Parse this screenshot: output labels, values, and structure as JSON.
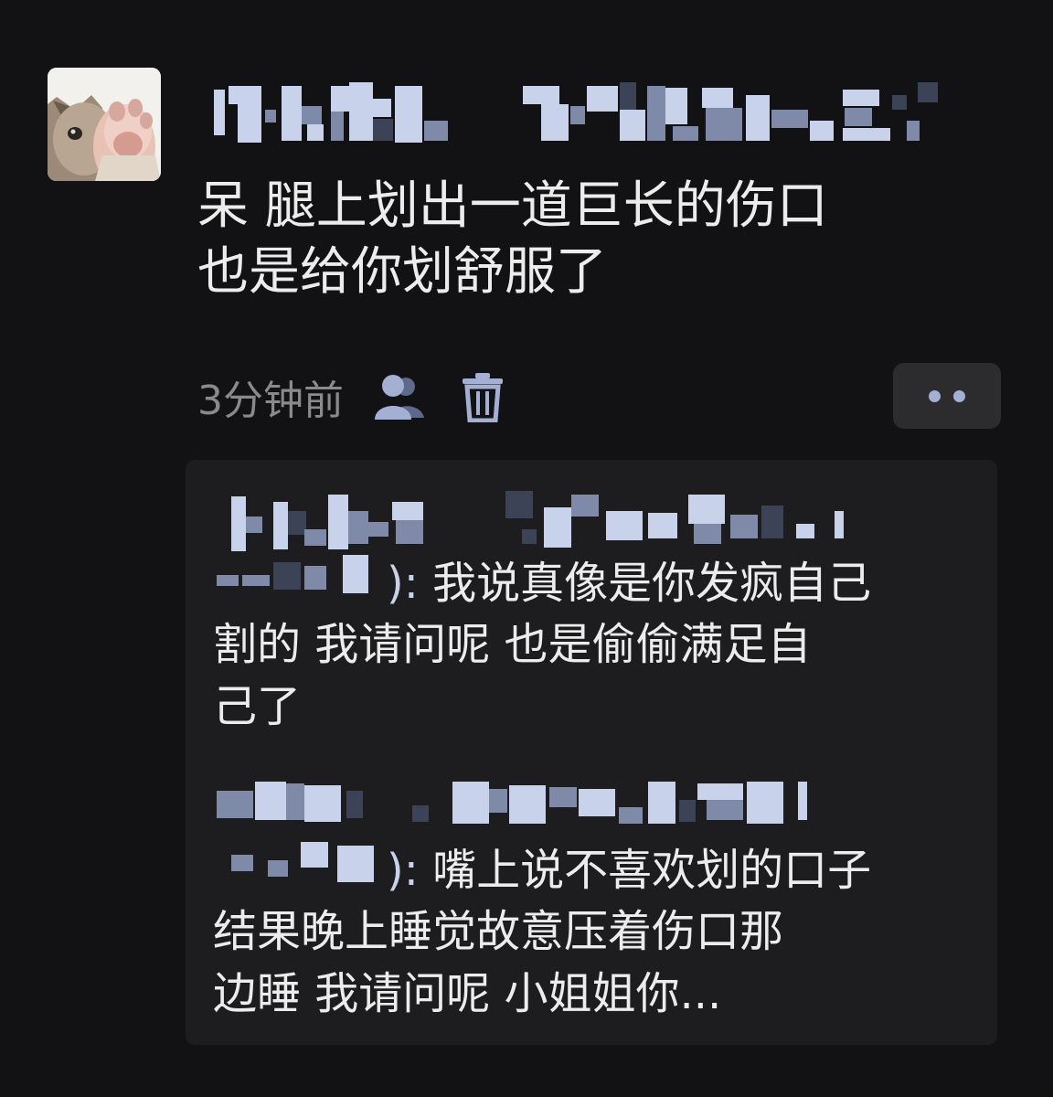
{
  "post": {
    "text_line1": "呆 腿上划出一道巨长的伤口",
    "text_line2": "也是给你划舒服了",
    "time": "3分钟前"
  },
  "icons": {
    "visibility": "people-icon",
    "delete": "trash-icon",
    "more": "more-dots-icon"
  },
  "comments": [
    {
      "suffix": "):",
      "text_first": "我说真像是你发疯自己",
      "text_line2": "割的 我请问呢 也是偷偷满足自",
      "text_line3": "己了"
    },
    {
      "suffix": "):",
      "text_first": "嘴上说不喜欢划的口子",
      "text_line2": " 结果晚上睡觉故意压着伤口那",
      "text_line3": "边睡 我请问呢 小姐姐你..."
    }
  ],
  "colors": {
    "background": "#121214",
    "name_blue": "#c8d2ea",
    "comment_bg": "#1d1d1f",
    "button_bg": "#2c2c2e"
  }
}
